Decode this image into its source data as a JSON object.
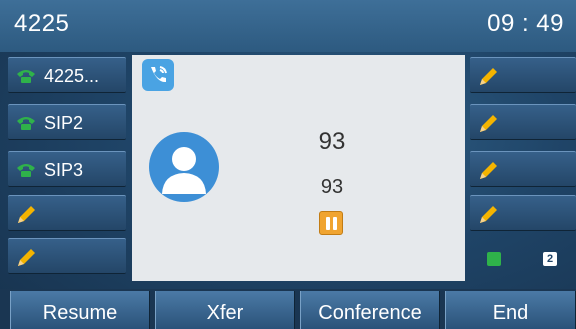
{
  "status_bar": {
    "title": "4225",
    "time": "09 : 49"
  },
  "left_keys": [
    {
      "label": "4225...",
      "icon": "phone-icon",
      "color": "#2fb24a"
    },
    {
      "label": "SIP2",
      "icon": "phone-icon",
      "color": "#2fb24a"
    },
    {
      "label": "SIP3",
      "icon": "phone-icon",
      "color": "#2fb24a"
    },
    {
      "label": "",
      "icon": "pencil-icon"
    },
    {
      "label": "",
      "icon": "pencil-icon"
    }
  ],
  "right_keys": [
    {
      "label": "",
      "icon": "pencil-icon"
    },
    {
      "label": "",
      "icon": "pencil-icon"
    },
    {
      "label": "",
      "icon": "pencil-icon"
    },
    {
      "label": "",
      "icon": "pencil-icon"
    }
  ],
  "call": {
    "type_icon": "call-incoming-icon",
    "avatar_icon": "contact-avatar-icon",
    "name": "93",
    "number": "93",
    "status_icon": "hold-icon",
    "status_color": "#f0a430"
  },
  "pages": {
    "current": "1",
    "next": "2"
  },
  "softkeys": [
    "Resume",
    "Xfer",
    "Conference",
    "End"
  ],
  "colors": {
    "accent": "#2d5a80",
    "line_registered": "#2fb24a",
    "panel": "#e6e9ec"
  }
}
